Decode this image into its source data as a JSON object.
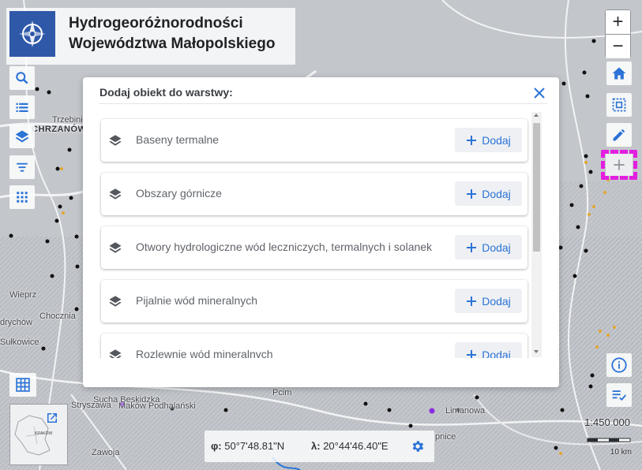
{
  "app": {
    "title_line1": "Hydrogeoróżnorodności",
    "title_line2": "Województwa Małopolskiego",
    "logo_icon": "compass-logo-icon",
    "brand_color": "#2f58a9",
    "accent_color": "#2b73d6"
  },
  "left_toolbar": [
    {
      "icon": "search-icon",
      "label": "search"
    },
    {
      "icon": "list-icon",
      "label": "legend"
    },
    {
      "icon": "layers-icon",
      "label": "layers"
    },
    {
      "icon": "filter-icon",
      "label": "filter"
    },
    {
      "icon": "apps-grid-icon",
      "label": "tools"
    }
  ],
  "right_toolbar": {
    "zoom_in": "+",
    "zoom_out": "−",
    "buttons": [
      {
        "icon": "home-icon"
      },
      {
        "icon": "select-area-icon"
      },
      {
        "icon": "edit-pencil-icon"
      },
      {
        "icon": "add-object-icon",
        "highlight_color": "#e41fe0"
      }
    ],
    "bottom_buttons": [
      {
        "icon": "info-icon"
      },
      {
        "icon": "checklist-icon"
      }
    ]
  },
  "dialog": {
    "title": "Dodaj obiekt do warstwy:",
    "close_icon": "close-icon",
    "items": [
      {
        "label": "Baseny termalne",
        "button": "Dodaj"
      },
      {
        "label": "Obszary górnicze",
        "button": "Dodaj"
      },
      {
        "label": "Otwory hydrologiczne wód leczniczych, termalnych i solanek",
        "button": "Dodaj"
      },
      {
        "label": "Pijalnie wód mineralnych",
        "button": "Dodaj"
      },
      {
        "label": "Rozlewnie wód mineralnych",
        "button": "Dodaj"
      }
    ]
  },
  "coordinates": {
    "phi_symbol": "φ:",
    "phi_value": "50°7'48.81\"N",
    "lambda_symbol": "λ:",
    "lambda_value": "20°44'46.40\"E",
    "settings_icon": "gear-icon"
  },
  "minimap": {
    "label": "KRAKÓW",
    "open_icon": "open-external-icon"
  },
  "basemap_button": {
    "icon": "grid-basemap-icon"
  },
  "scale": {
    "ratio": "1:450 000",
    "unit": "10 km"
  },
  "map_labels": {
    "chrzanow": "CHRZANÓW",
    "trzebinia": "Trzebini",
    "wieprz": "Wieprz",
    "chocznia": "Chocznia",
    "jedrychow": "drychów",
    "sulkowice": "Sułkowice",
    "sucha": "Sucha Beskidzka",
    "stryszawa": "Stryszawa",
    "makow": "Maków Podhalański",
    "limanowa": "Limanowa",
    "pcim": "Pcim",
    "zawoja": "Zawoja",
    "mszana": "pnice"
  }
}
